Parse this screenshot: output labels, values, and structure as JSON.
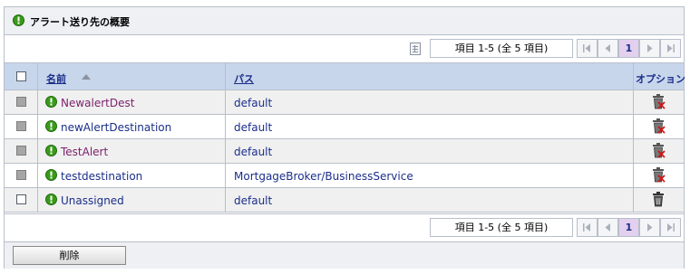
{
  "panel": {
    "title": "アラート送り先の概要",
    "title_icon": "green-info-icon"
  },
  "pager": {
    "count_label": "項目  1-5  (全 5 項目)",
    "current_page": "1"
  },
  "table": {
    "headers": {
      "name": "名前",
      "path": "パス",
      "options": "オプション"
    },
    "rows": [
      {
        "name": "NewalertDest",
        "path": "default",
        "visited": true,
        "checkbox_enabled": false
      },
      {
        "name": "newAlertDestination",
        "path": "default",
        "visited": false,
        "checkbox_enabled": false
      },
      {
        "name": "TestAlert",
        "path": "default",
        "visited": true,
        "checkbox_enabled": false
      },
      {
        "name": "testdestination",
        "path": "MortgageBroker/BusinessService",
        "visited": false,
        "checkbox_enabled": false
      },
      {
        "name": "Unassigned",
        "path": "default",
        "visited": false,
        "checkbox_enabled": true
      }
    ]
  },
  "footer": {
    "delete_label": "削除"
  },
  "colors": {
    "header_bg": "#c8d6ec",
    "link": "#1a2e8a",
    "visited": "#7b1f6b",
    "info_green": "#3a9a1a",
    "current_page_bg": "#e3d0ef"
  }
}
